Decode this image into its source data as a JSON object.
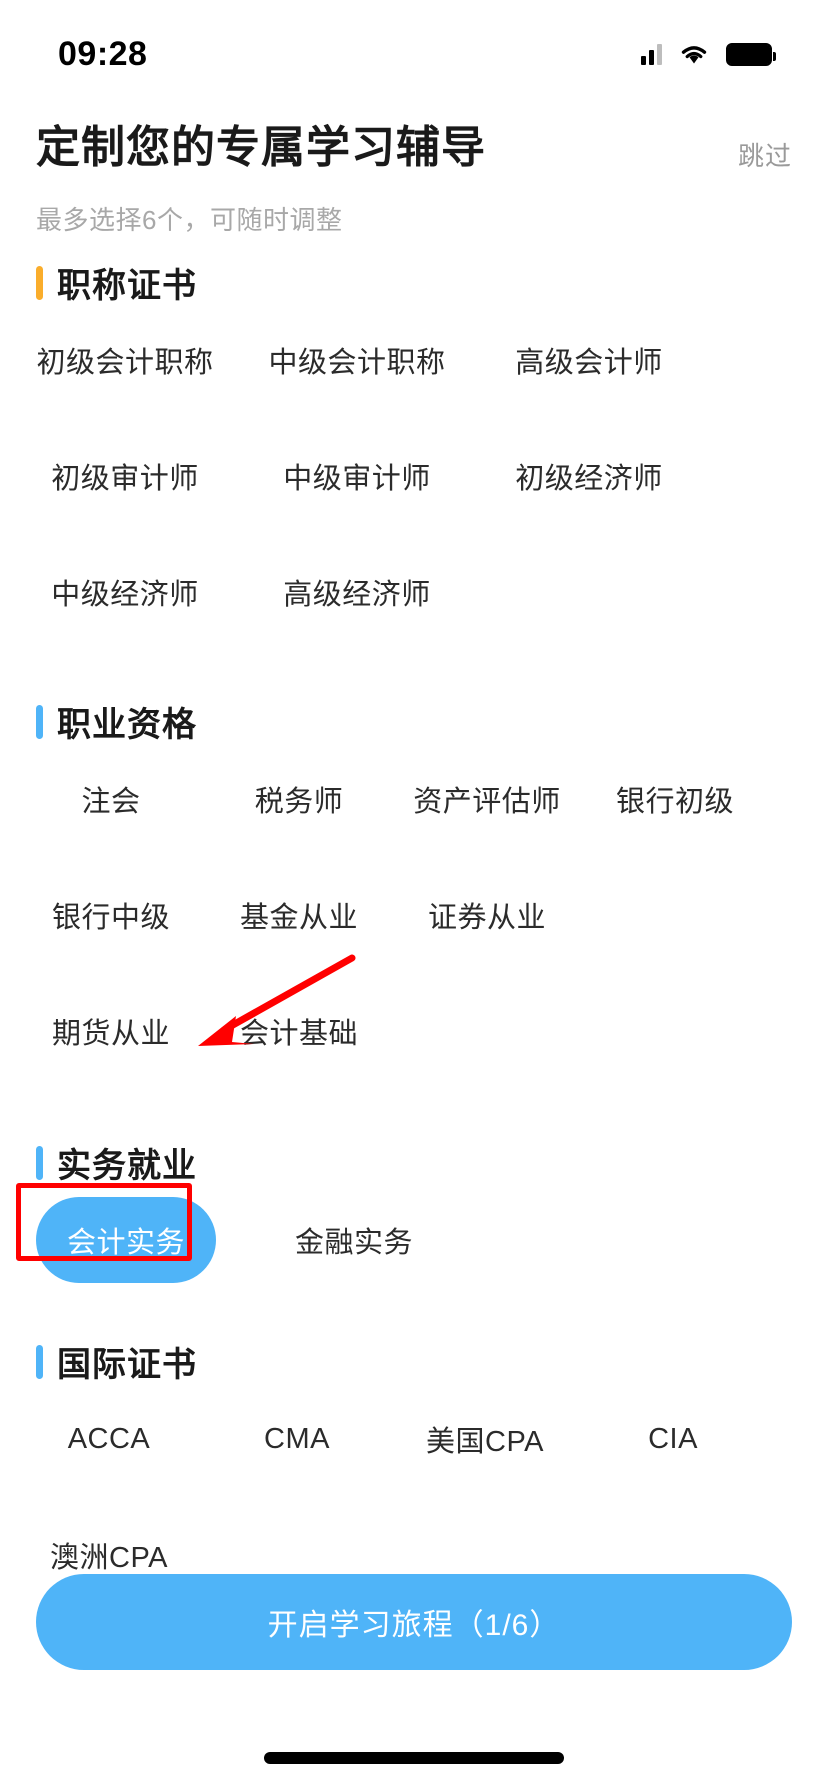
{
  "statusbar": {
    "time": "09:28",
    "signal_icon": "cellular-signal-icon",
    "wifi_icon": "wifi-icon",
    "battery_icon": "battery-full-icon"
  },
  "header": {
    "title": "定制您的专属学习辅导",
    "skip_label": "跳过",
    "subtitle": "最多选择6个，可随时调整"
  },
  "sections": [
    {
      "id": "title-certificates",
      "title": "职称证书",
      "accent_color": "#FAAD2B",
      "items": [
        {
          "label": "初级会计职称",
          "selected": false
        },
        {
          "label": "中级会计职称",
          "selected": false
        },
        {
          "label": "高级会计师",
          "selected": false
        },
        {
          "label": "初级审计师",
          "selected": false
        },
        {
          "label": "中级审计师",
          "selected": false
        },
        {
          "label": "初级经济师",
          "selected": false
        },
        {
          "label": "中级经济师",
          "selected": false
        },
        {
          "label": "高级经济师",
          "selected": false
        }
      ]
    },
    {
      "id": "professional-qualification",
      "title": "职业资格",
      "accent_color": "#4FB4F8",
      "items": [
        {
          "label": "注会",
          "selected": false
        },
        {
          "label": "税务师",
          "selected": false
        },
        {
          "label": "资产评估师",
          "selected": false
        },
        {
          "label": "银行初级",
          "selected": false
        },
        {
          "label": "银行中级",
          "selected": false
        },
        {
          "label": "基金从业",
          "selected": false
        },
        {
          "label": "证券从业",
          "selected": false
        },
        {
          "label": "期货从业",
          "selected": false
        },
        {
          "label": "会计基础",
          "selected": false
        }
      ]
    },
    {
      "id": "practical-employment",
      "title": "实务就业",
      "accent_color": "#4FB4F8",
      "items": [
        {
          "label": "会计实务",
          "selected": true
        },
        {
          "label": "金融实务",
          "selected": false
        }
      ]
    },
    {
      "id": "international-certificates",
      "title": "国际证书",
      "accent_color": "#4FB4F8",
      "items": [
        {
          "label": "ACCA",
          "selected": false
        },
        {
          "label": "CMA",
          "selected": false
        },
        {
          "label": "美国CPA",
          "selected": false
        },
        {
          "label": "CIA",
          "selected": false
        },
        {
          "label": "澳洲CPA",
          "selected": false
        }
      ]
    }
  ],
  "cta": {
    "label": "开启学习旅程（1/6）",
    "selected_count": 1,
    "max_count": 6,
    "color": "#4FB4F8"
  },
  "annotations": {
    "highlight_color": "#FF0000",
    "highlight_target": "会计实务",
    "arrow_target": "实务就业"
  },
  "colors": {
    "accent_blue": "#4FB4F8",
    "accent_orange": "#FAAD2B",
    "text_primary": "#1a1a1a",
    "text_chip": "#2b2b2b",
    "text_muted": "#a8a8a8",
    "background": "#ffffff"
  }
}
